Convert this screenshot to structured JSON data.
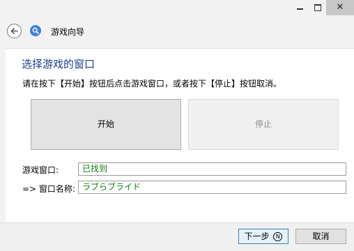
{
  "window": {
    "minimize_icon": "minimize-icon",
    "maximize_icon": "maximize-icon",
    "close_glyph": "✕"
  },
  "header": {
    "title": "游戏向导",
    "back_icon": "back-arrow-icon",
    "app_icon": "search-icon"
  },
  "main": {
    "title": "选择游戏的窗口",
    "instruction": "请在按下【开始】按钮后点击游戏窗口，或者按下【停止】按钮取消。",
    "start_label": "开始",
    "stop_label": "停止",
    "game_window_label": "游戏窗口:",
    "game_window_value": "已找到",
    "window_name_label": "=> 窗口名称:",
    "window_name_value": "ラブらブライド"
  },
  "footer": {
    "next_label": "下一步",
    "next_mnemonic": "N",
    "cancel_label": "取消"
  },
  "colors": {
    "title_blue": "#1a3e8c",
    "value_green": "#117a11",
    "disabled_text": "#8c8c8c"
  }
}
